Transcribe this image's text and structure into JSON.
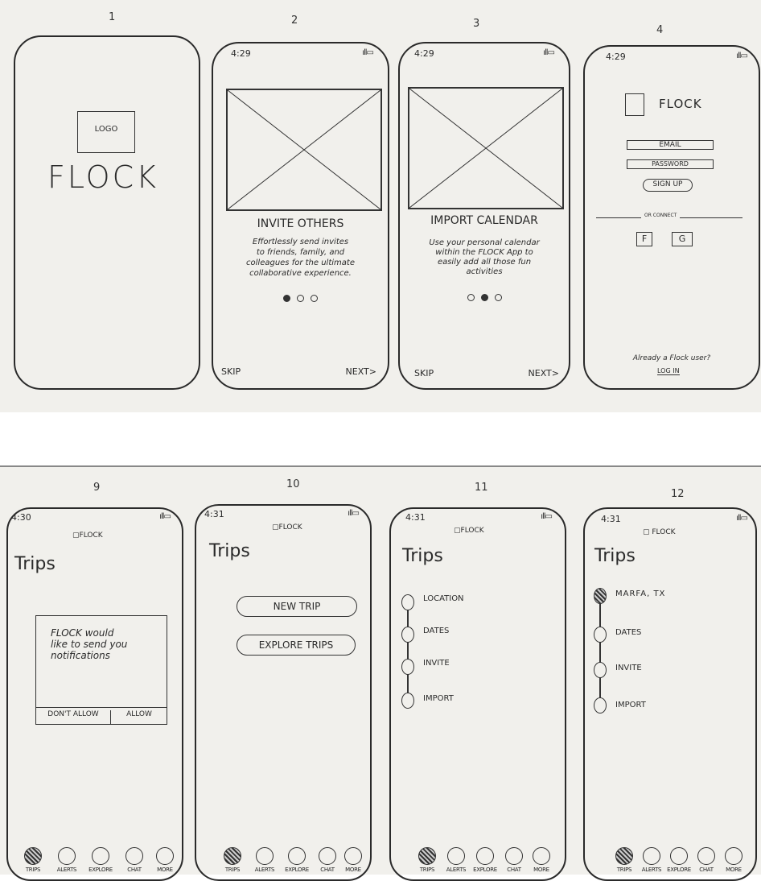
{
  "screens": {
    "s1": {
      "number": "1",
      "logo": "LOGO",
      "brand": "FLOCK"
    },
    "s2": {
      "number": "2",
      "time": "4:29",
      "heading": "INVITE OTHERS",
      "body": [
        "Effortlessly send invites",
        "to friends, family, and",
        "colleagues for the ultimate",
        "collaborative experience."
      ],
      "skip": "SKIP",
      "next": "NEXT>"
    },
    "s3": {
      "number": "3",
      "time": "4:29",
      "heading": "IMPORT CALENDAR",
      "body": [
        "Use your personal calendar",
        "within the FLOCK App to",
        "easily add all those fun",
        "activities"
      ],
      "skip": "SKIP",
      "next": "NEXT>"
    },
    "s4": {
      "number": "4",
      "time": "4:29",
      "brand": "FLOCK",
      "email": "EMAIL",
      "password": "PASSWORD",
      "signup": "SIGN UP",
      "or_connect": "OR CONNECT",
      "facebook": "F",
      "google": "G",
      "already": "Already a Flock user?",
      "login": "LOG IN"
    },
    "s9": {
      "number": "9",
      "time": "4:30",
      "brand": "FLOCK",
      "title": "Trips",
      "dialog": [
        "FLOCK would",
        "like to send you",
        "notifications"
      ],
      "dont_allow": "DON'T ALLOW",
      "allow": "ALLOW"
    },
    "s10": {
      "number": "10",
      "time": "4:31",
      "brand": "FLOCK",
      "title": "Trips",
      "new_trip": "NEW TRIP",
      "explore_trips": "EXPLORE TRIPS"
    },
    "s11": {
      "number": "11",
      "time": "4:31",
      "brand": "FLOCK",
      "title": "Trips",
      "steps": [
        "LOCATION",
        "DATES",
        "INVITE",
        "IMPORT"
      ]
    },
    "s12": {
      "number": "12",
      "time": "4:31",
      "brand": "FLOCK",
      "title": "Trips",
      "steps": [
        "MARFA, TX",
        "DATES",
        "INVITE",
        "IMPORT"
      ]
    }
  },
  "tabs": [
    "TRIPS",
    "ALERTS",
    "EXPLORE",
    "CHAT",
    "MORE"
  ],
  "status_icon": "signal-battery"
}
